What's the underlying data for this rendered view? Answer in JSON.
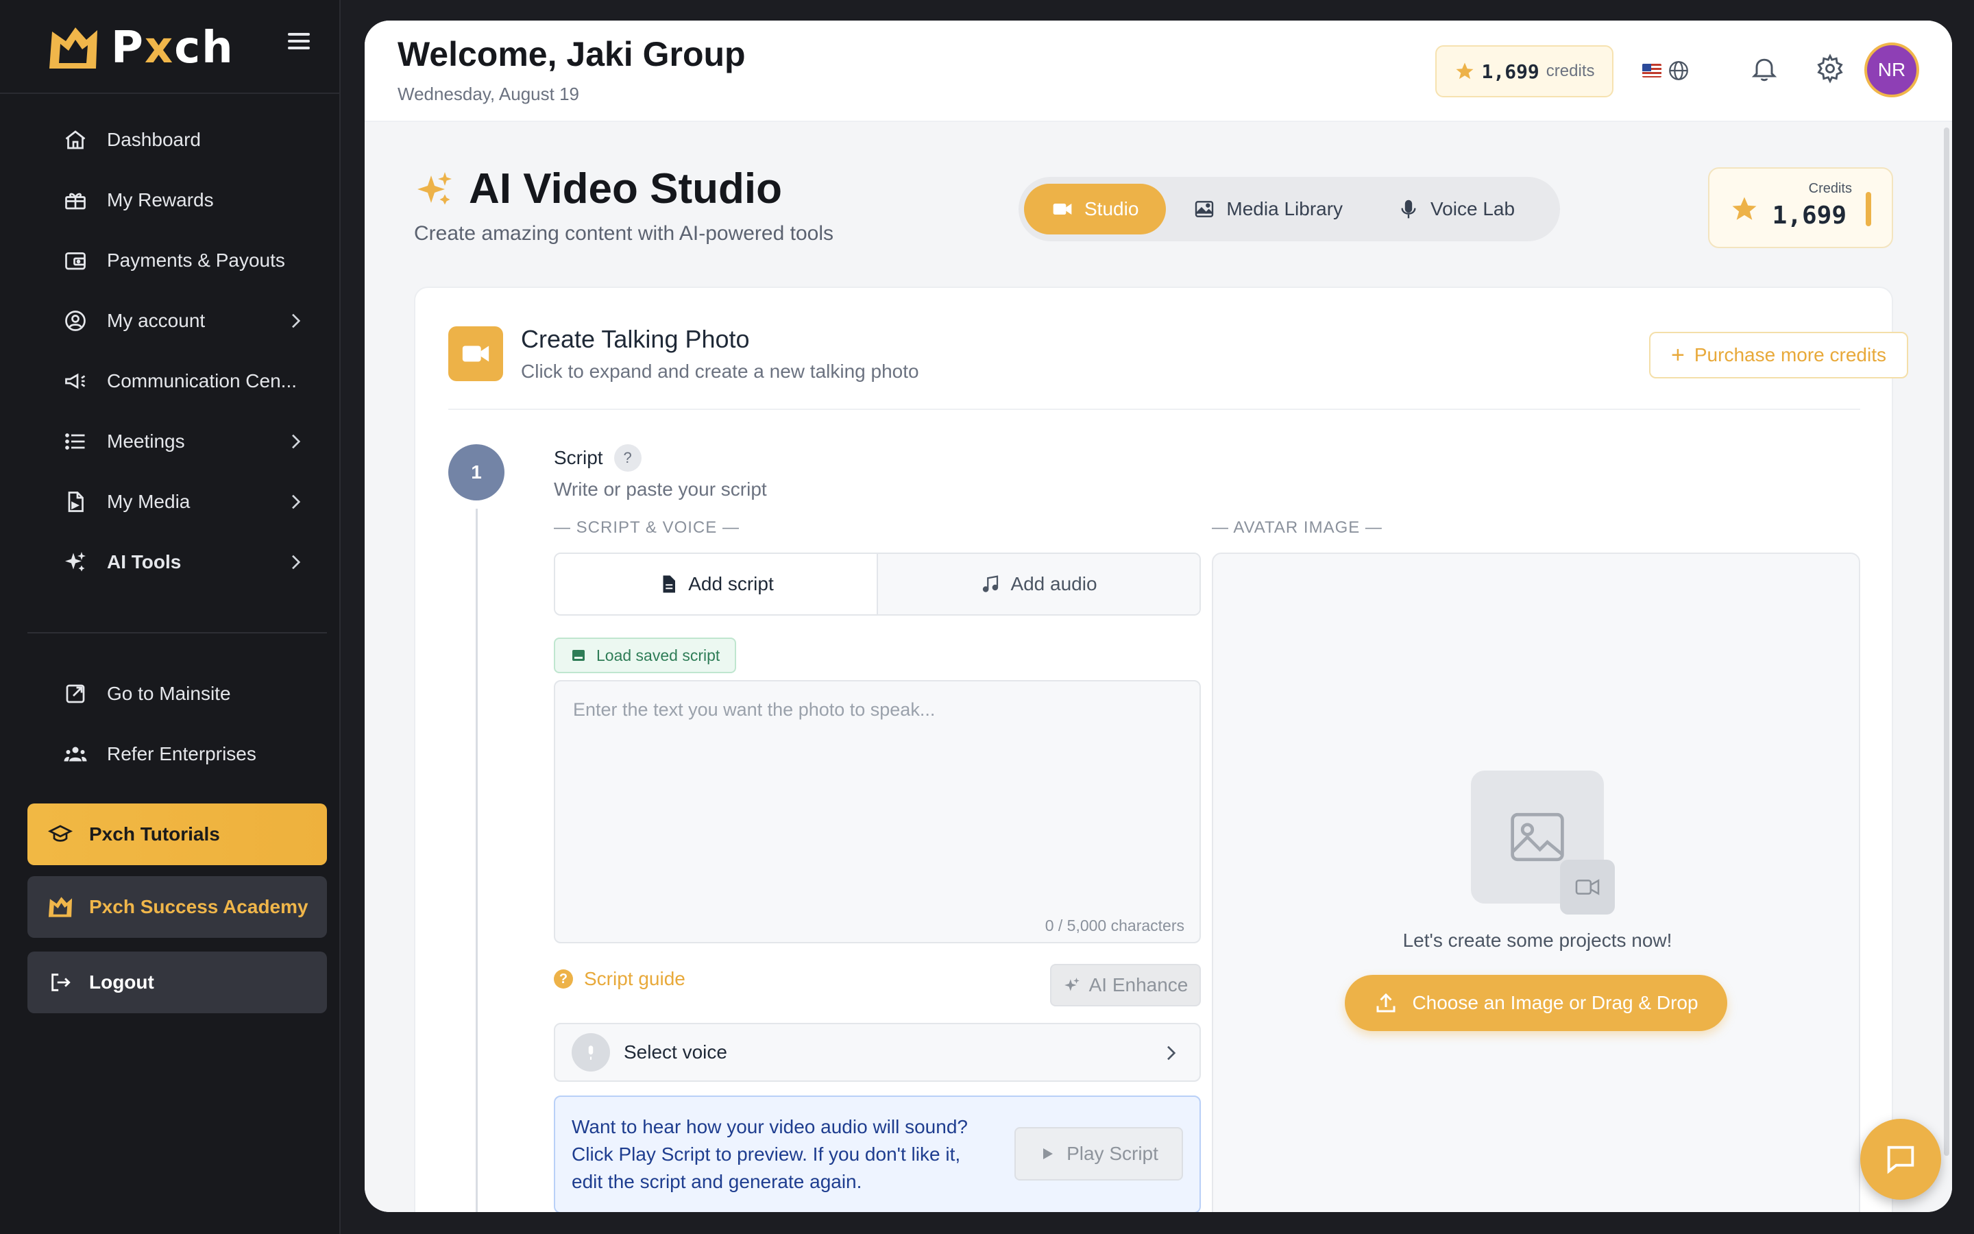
{
  "brand": {
    "name_prefix": "P",
    "name_x": "x",
    "name_suffix": "ch"
  },
  "sidebar": {
    "items": [
      {
        "label": "Dashboard",
        "icon": "home-icon"
      },
      {
        "label": "My Rewards",
        "icon": "rewards-icon"
      },
      {
        "label": "Payments & Payouts",
        "icon": "wallet-icon"
      },
      {
        "label": "My account",
        "icon": "user-circle-icon",
        "has_children": true
      },
      {
        "label": "Communication Cen...",
        "icon": "megaphone-icon"
      },
      {
        "label": "Meetings",
        "icon": "list-icon",
        "has_children": true
      },
      {
        "label": "My Media",
        "icon": "media-file-icon",
        "has_children": true
      },
      {
        "label": "AI Tools",
        "icon": "sparkles-icon",
        "has_children": true
      }
    ],
    "secondary": [
      {
        "label": "Go to Mainsite",
        "icon": "external-link-icon"
      },
      {
        "label": "Refer Enterprises",
        "icon": "users-icon"
      }
    ],
    "tutorials_label": "Pxch Tutorials",
    "academy_label": "Pxch Success Academy",
    "logout_label": "Logout"
  },
  "header": {
    "welcome": "Welcome, Jaki Group",
    "date": "Wednesday, August 19",
    "credits_value": "1,699",
    "credits_label": "credits",
    "avatar_initials": "NR"
  },
  "studio": {
    "title": "AI Video Studio",
    "subtitle": "Create amazing content with AI-powered tools",
    "tabs": [
      {
        "label": "Studio",
        "icon": "video-camera-icon",
        "active": true
      },
      {
        "label": "Media Library",
        "icon": "image-icon",
        "active": false
      },
      {
        "label": "Voice Lab",
        "icon": "microphone-icon",
        "active": false
      }
    ],
    "credits_card": {
      "label": "Credits",
      "value": "1,699"
    }
  },
  "create_card": {
    "title": "Create Talking Photo",
    "subtitle": "Click to expand and create a new talking photo",
    "purchase_label": "Purchase more credits"
  },
  "step1": {
    "number": "1",
    "title": "Script",
    "help": "?",
    "subtitle": "Write or paste your script",
    "script_voice_label": "— SCRIPT & VOICE —",
    "avatar_label": "— AVATAR IMAGE —",
    "add_script": "Add script",
    "add_audio": "Add audio",
    "load_saved": "Load saved script",
    "placeholder": "Enter the text you want the photo to speak...",
    "char_count": "0 / 5,000 characters",
    "script_guide": "Script guide",
    "ai_enhance": "AI Enhance",
    "select_voice": "Select voice",
    "preview_text": "Want to hear how your video audio will sound? Click Play Script to preview. If you don't like it, edit the script and generate again.",
    "play_script": "Play Script",
    "empty_text": "Let's create some projects now!",
    "upload_label": "Choose an Image or Drag & Drop"
  },
  "colors": {
    "accent": "#edb248",
    "sidebar_bg": "#18191d",
    "avatar_bg": "#8e3fb5",
    "step_circle": "#7384a6",
    "info_text": "#1e3d8f"
  }
}
